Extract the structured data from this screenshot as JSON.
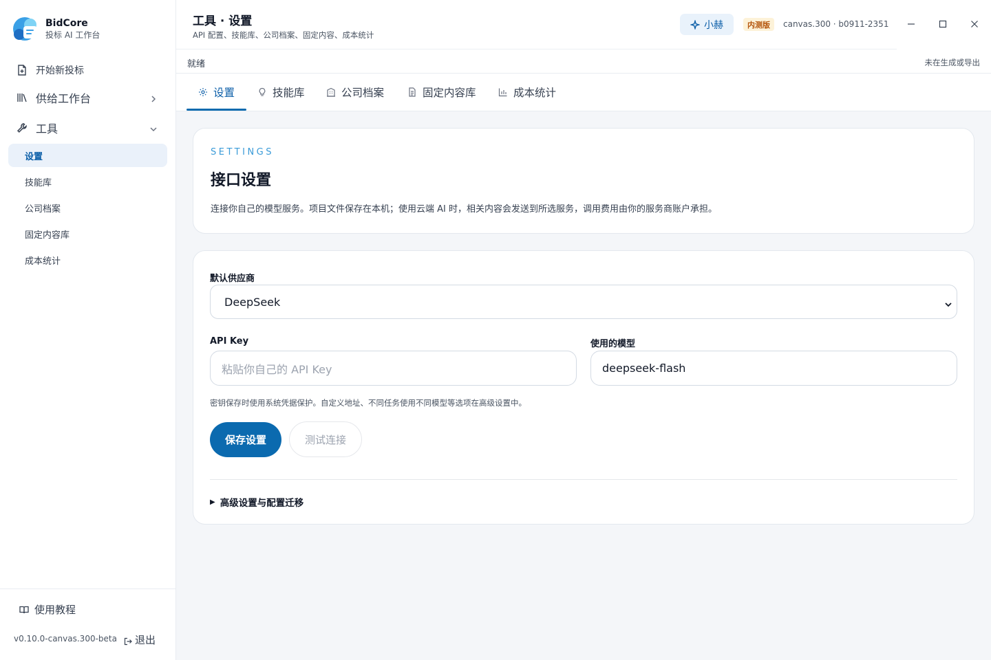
{
  "brand": {
    "name": "BidCore",
    "subtitle": "投标 AI 工作台"
  },
  "sidebar": {
    "items": [
      {
        "label": "开始新投标",
        "icon": "new-document-icon"
      },
      {
        "label": "供给工作台",
        "icon": "library-icon"
      },
      {
        "label": "工具",
        "icon": "wrench-icon"
      }
    ],
    "tools_sub": [
      {
        "label": "设置",
        "active": true
      },
      {
        "label": "技能库"
      },
      {
        "label": "公司档案"
      },
      {
        "label": "固定内容库"
      },
      {
        "label": "成本统计"
      }
    ],
    "tutorial": "使用教程",
    "version": "v0.10.0-canvas.300-beta",
    "logout": "退出"
  },
  "header": {
    "title": "工具 · 设置",
    "subtitle": "API 配置、技能库、公司档案、固定内容、成本统计",
    "assistant": "小赫",
    "beta_badge": "内测版",
    "build": "canvas.300 · b0911-2351"
  },
  "status": {
    "left": "就绪",
    "right": "未在生成或导出"
  },
  "tabs": [
    {
      "label": "设置",
      "icon": "gear-icon",
      "active": true
    },
    {
      "label": "技能库",
      "icon": "lightbulb-icon"
    },
    {
      "label": "公司档案",
      "icon": "building-icon"
    },
    {
      "label": "固定内容库",
      "icon": "document-icon"
    },
    {
      "label": "成本统计",
      "icon": "bar-chart-icon"
    }
  ],
  "intro": {
    "eyebrow": "SETTINGS",
    "title": "接口设置",
    "description": "连接你自己的模型服务。项目文件保存在本机；使用云端 AI 时，相关内容会发送到所选服务，调用费用由你的服务商账户承担。"
  },
  "form": {
    "provider_label": "默认供应商",
    "provider_value": "DeepSeek",
    "api_key_label": "API Key",
    "api_key_placeholder": "粘贴你自己的 API Key",
    "model_label": "使用的模型",
    "model_value": "deepseek-flash",
    "hint": "密钥保存时使用系统凭据保护。自定义地址、不同任务使用不同模型等选项在高级设置中。",
    "save_button": "保存设置",
    "test_button": "测试连接",
    "advanced": "高级设置与配置迁移"
  },
  "colors": {
    "accent": "#0b6aaf",
    "active_bg": "#eaf1fa",
    "badge_bg": "#fdf2d8",
    "badge_fg": "#b4540a"
  }
}
